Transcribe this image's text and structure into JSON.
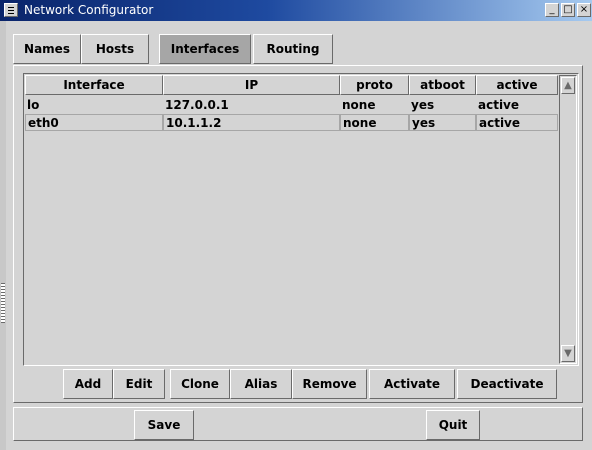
{
  "window": {
    "title": "Network Configurator"
  },
  "titlebar_icons": [
    "menu-icon",
    "minimize-icon",
    "maximize-icon",
    "close-icon"
  ],
  "tabs": [
    {
      "label": "Names",
      "selected": false
    },
    {
      "label": "Hosts",
      "selected": false
    },
    {
      "label": "Interfaces",
      "selected": true
    },
    {
      "label": "Routing",
      "selected": false
    }
  ],
  "table": {
    "columns": [
      "Interface",
      "IP",
      "proto",
      "atboot",
      "active"
    ],
    "rows": [
      {
        "cells": [
          "lo",
          "127.0.0.1",
          "none",
          "yes",
          "active"
        ],
        "selected": false
      },
      {
        "cells": [
          "eth0",
          "10.1.1.2",
          "none",
          "yes",
          "active"
        ],
        "selected": true
      }
    ]
  },
  "actions": [
    "Add",
    "Edit",
    "Clone",
    "Alias",
    "Remove",
    "Activate",
    "Deactivate"
  ],
  "footer": {
    "save_label": "Save",
    "quit_label": "Quit"
  },
  "colors": {
    "title_start": "#0a246a",
    "title_end": "#a6caf0",
    "face": "#d4d4d4",
    "selected_tab": "#a6a6a6"
  }
}
